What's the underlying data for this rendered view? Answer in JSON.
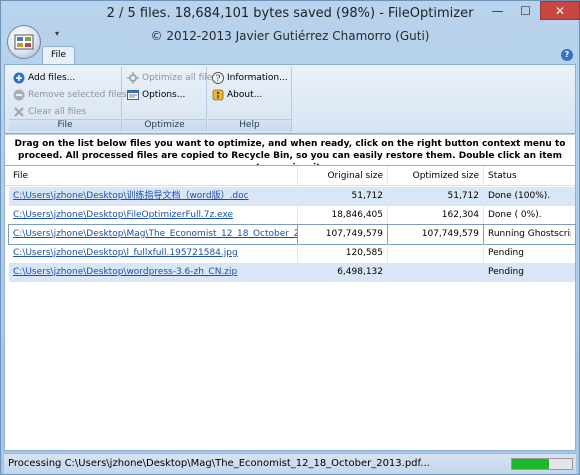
{
  "window": {
    "title": "2 / 5 files. 18,684,101 bytes saved (98%) - FileOptimizer",
    "subtitle": "© 2012-2013 Javier Gutiérrez Chamorro (Guti)",
    "min_glyph": "—",
    "max_glyph": "☐",
    "close_glyph": "✕"
  },
  "ribbon": {
    "tab_file": "File",
    "help_glyph": "?",
    "qat_glyph": "▾",
    "groups": {
      "file": {
        "label": "File",
        "add_files": "Add files...",
        "remove_selected": "Remove selected files",
        "clear_all": "Clear all files"
      },
      "optimize": {
        "label": "Optimize",
        "optimize_all": "Optimize all files",
        "options": "Options..."
      },
      "help": {
        "label": "Help",
        "information": "Information...",
        "about": "About..."
      }
    }
  },
  "instructions": "Drag on the list below files you want to optimize, and when ready, click on the right button context menu to proceed. All processed files are copied to Recycle Bin, so you can easily restore them. Double click an item to preview it.",
  "list": {
    "columns": {
      "file": "File",
      "original_size": "Original size",
      "optimized_size": "Optimized size",
      "status": "Status"
    },
    "rows": [
      {
        "file": "C:\\Users\\jzhone\\Desktop\\训练指导文档（word版）.doc",
        "original": "51,712",
        "optimized": "51,712",
        "status": "Done (100%)."
      },
      {
        "file": "C:\\Users\\jzhone\\Desktop\\FileOptimizerFull.7z.exe",
        "original": "18,846,405",
        "optimized": "162,304",
        "status": "Done (  0%)."
      },
      {
        "file": "C:\\Users\\jzhone\\Desktop\\Mag\\The_Economist_12_18_October_2013.pdf",
        "original": "107,749,579",
        "optimized": "107,749,579",
        "status": "Running Ghostscript..."
      },
      {
        "file": "C:\\Users\\jzhone\\Desktop\\l_fullxfull.195721584.jpg",
        "original": "120,585",
        "optimized": "",
        "status": "Pending"
      },
      {
        "file": "C:\\Users\\jzhone\\Desktop\\wordpress-3.6-zh_CN.zip",
        "original": "6,498,132",
        "optimized": "",
        "status": "Pending"
      }
    ]
  },
  "statusbar": {
    "text": "Processing C:\\Users\\jzhone\\Desktop\\Mag\\The_Economist_12_18_October_2013.pdf...",
    "progress_fraction": 0.62
  },
  "colors": {
    "accent": "#3472c4",
    "close": "#c7463f",
    "progress": "#1fb82a",
    "link": "#1a4fb0"
  }
}
